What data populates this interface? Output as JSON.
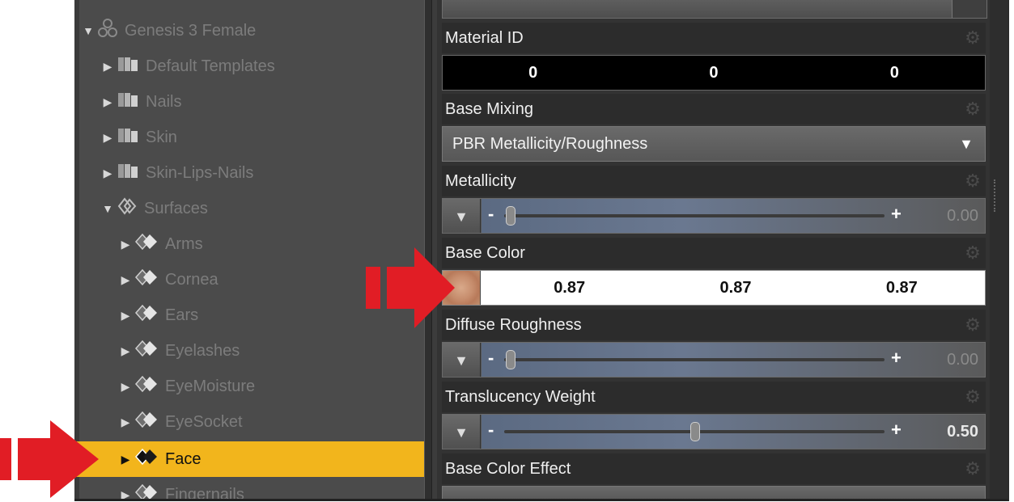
{
  "tree": {
    "root": {
      "label": "Genesis 3 Female"
    },
    "items": [
      {
        "label": "Default Templates"
      },
      {
        "label": "Nails"
      },
      {
        "label": "Skin"
      },
      {
        "label": "Skin-Lips-Nails"
      }
    ],
    "surfaces": {
      "label": "Surfaces"
    },
    "surface_items": [
      {
        "label": "Arms"
      },
      {
        "label": "Cornea"
      },
      {
        "label": "Ears"
      },
      {
        "label": "Eyelashes"
      },
      {
        "label": "EyeMoisture"
      },
      {
        "label": "EyeSocket"
      },
      {
        "label": "Face"
      },
      {
        "label": "Fingernails"
      }
    ],
    "selected": "Face"
  },
  "properties": {
    "material_id": {
      "label": "Material ID",
      "values": [
        "0",
        "0",
        "0"
      ]
    },
    "base_mixing": {
      "label": "Base Mixing",
      "value": "PBR Metallicity/Roughness"
    },
    "metallicity": {
      "label": "Metallicity",
      "value": "0.00",
      "fraction": 0.0
    },
    "base_color": {
      "label": "Base Color",
      "values": [
        "0.87",
        "0.87",
        "0.87"
      ],
      "swatch_color": "#c9916f"
    },
    "diffuse_roughness": {
      "label": "Diffuse Roughness",
      "value": "0.00",
      "fraction": 0.0
    },
    "translucency_weight": {
      "label": "Translucency Weight",
      "value": "0.50",
      "fraction": 0.5
    },
    "base_color_effect": {
      "label": "Base Color Effect"
    }
  },
  "colors": {
    "selection": "#f2b51c",
    "annotation_arrow": "#e11d25"
  }
}
